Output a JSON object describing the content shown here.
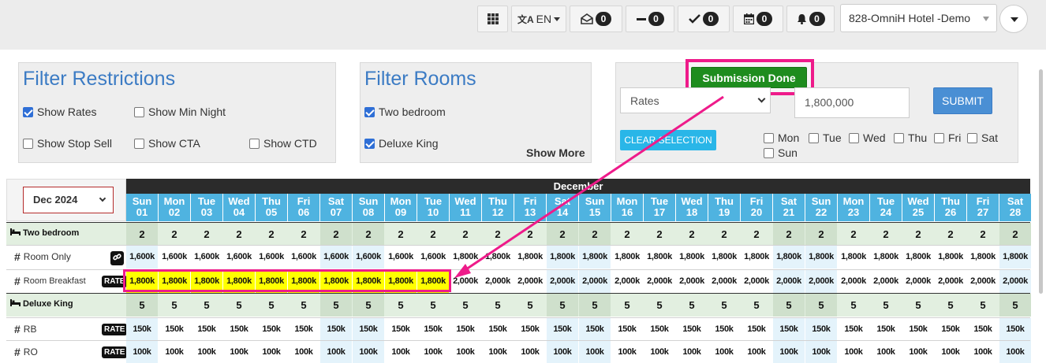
{
  "header": {
    "grid_menu_icon": "grid-icon",
    "language": "EN",
    "counters": [
      {
        "icon": "envelope-open-icon",
        "count": "0"
      },
      {
        "icon": "minus-icon",
        "count": "0"
      },
      {
        "icon": "check-icon",
        "count": "0"
      },
      {
        "icon": "calendar-icon",
        "count": "0"
      },
      {
        "icon": "bell-icon",
        "count": "0"
      }
    ],
    "hotel": "828-OmniH Hotel -Demo"
  },
  "filter_restrictions": {
    "title": "Filter Restrictions",
    "options": [
      {
        "label": "Show Rates",
        "checked": true
      },
      {
        "label": "Show Min Night",
        "checked": false
      },
      {
        "label": "Show Stop Sell",
        "checked": false
      },
      {
        "label": "Show CTA",
        "checked": false
      },
      {
        "label": "Show CTD",
        "checked": false
      }
    ]
  },
  "filter_rooms": {
    "title": "Filter Rooms",
    "options": [
      {
        "label": "Two bedroom",
        "checked": true
      },
      {
        "label": "Deluxe King",
        "checked": true
      }
    ],
    "show_more": "Show More"
  },
  "bulk_update": {
    "status": "Submission Done",
    "type_select": "Rates",
    "value": "1,800,000",
    "submit": "SUBMIT",
    "clear": "CLEAR SELECTION",
    "days": [
      {
        "label": "Mon",
        "checked": false
      },
      {
        "label": "Tue",
        "checked": false
      },
      {
        "label": "Wed",
        "checked": false
      },
      {
        "label": "Thu",
        "checked": false
      },
      {
        "label": "Fri",
        "checked": false
      },
      {
        "label": "Sat",
        "checked": false
      },
      {
        "label": "Sun",
        "checked": false
      }
    ]
  },
  "calendar": {
    "month_select": "Dec 2024",
    "month_label": "December",
    "days": [
      {
        "dow": "Sun",
        "d": "01"
      },
      {
        "dow": "Mon",
        "d": "02"
      },
      {
        "dow": "Tue",
        "d": "03"
      },
      {
        "dow": "Wed",
        "d": "04"
      },
      {
        "dow": "Thu",
        "d": "05"
      },
      {
        "dow": "Fri",
        "d": "06"
      },
      {
        "dow": "Sat",
        "d": "07"
      },
      {
        "dow": "Sun",
        "d": "08"
      },
      {
        "dow": "Mon",
        "d": "09"
      },
      {
        "dow": "Tue",
        "d": "10"
      },
      {
        "dow": "Wed",
        "d": "11"
      },
      {
        "dow": "Thu",
        "d": "12"
      },
      {
        "dow": "Fri",
        "d": "13"
      },
      {
        "dow": "Sat",
        "d": "14"
      },
      {
        "dow": "Sun",
        "d": "15"
      },
      {
        "dow": "Mon",
        "d": "16"
      },
      {
        "dow": "Tue",
        "d": "17"
      },
      {
        "dow": "Wed",
        "d": "18"
      },
      {
        "dow": "Thu",
        "d": "19"
      },
      {
        "dow": "Fri",
        "d": "20"
      },
      {
        "dow": "Sat",
        "d": "21"
      },
      {
        "dow": "Sun",
        "d": "22"
      },
      {
        "dow": "Mon",
        "d": "23"
      },
      {
        "dow": "Tue",
        "d": "24"
      },
      {
        "dow": "Wed",
        "d": "25"
      },
      {
        "dow": "Thu",
        "d": "26"
      },
      {
        "dow": "Fri",
        "d": "27"
      },
      {
        "dow": "Sat",
        "d": "28"
      }
    ],
    "rows": [
      {
        "kind": "room",
        "label": "Two bedroom",
        "icon": "bed-icon",
        "values": [
          "2",
          "2",
          "2",
          "2",
          "2",
          "2",
          "2",
          "2",
          "2",
          "2",
          "2",
          "2",
          "2",
          "2",
          "2",
          "2",
          "2",
          "2",
          "2",
          "2",
          "2",
          "2",
          "2",
          "2",
          "2",
          "2",
          "2",
          "2"
        ]
      },
      {
        "kind": "rate",
        "label": "Room Only",
        "tag_icon": "link-icon",
        "values": [
          "1,600k",
          "1,600k",
          "1,600k",
          "1,600k",
          "1,600k",
          "1,600k",
          "1,600k",
          "1,600k",
          "1,600k",
          "1,600k",
          "1,800k",
          "1,800k",
          "1,800k",
          "1,800k",
          "1,800k",
          "1,800k",
          "1,800k",
          "1,800k",
          "1,800k",
          "1,800k",
          "1,800k",
          "1,800k",
          "1,800k",
          "1,800k",
          "1,800k",
          "1,800k",
          "1,800k",
          "1,800k"
        ]
      },
      {
        "kind": "rate",
        "label": "Room Breakfast",
        "tag": "RATE",
        "highlight_count": 10,
        "values": [
          "1,800k",
          "1,800k",
          "1,800k",
          "1,800k",
          "1,800k",
          "1,800k",
          "1,800k",
          "1,800k",
          "1,800k",
          "1,800k",
          "2,000k",
          "2,000k",
          "2,000k",
          "2,000k",
          "2,000k",
          "2,000k",
          "2,000k",
          "2,000k",
          "2,000k",
          "2,000k",
          "2,000k",
          "2,000k",
          "2,000k",
          "2,000k",
          "2,000k",
          "2,000k",
          "2,000k",
          "2,000k"
        ]
      },
      {
        "kind": "room",
        "label": "Deluxe King",
        "icon": "bed-icon",
        "values": [
          "5",
          "5",
          "5",
          "5",
          "5",
          "5",
          "5",
          "5",
          "5",
          "5",
          "5",
          "5",
          "5",
          "5",
          "5",
          "5",
          "5",
          "5",
          "5",
          "5",
          "5",
          "5",
          "5",
          "5",
          "5",
          "5",
          "5",
          "5"
        ]
      },
      {
        "kind": "rate",
        "label": "RB",
        "tag": "RATE",
        "values": [
          "150k",
          "150k",
          "150k",
          "150k",
          "150k",
          "150k",
          "150k",
          "150k",
          "150k",
          "150k",
          "150k",
          "150k",
          "150k",
          "150k",
          "150k",
          "150k",
          "150k",
          "150k",
          "150k",
          "150k",
          "150k",
          "150k",
          "150k",
          "150k",
          "150k",
          "150k",
          "150k",
          "150k"
        ]
      },
      {
        "kind": "rate",
        "label": "RO",
        "tag": "RATE",
        "values": [
          "100k",
          "100k",
          "100k",
          "100k",
          "100k",
          "100k",
          "100k",
          "100k",
          "100k",
          "100k",
          "100k",
          "100k",
          "100k",
          "100k",
          "100k",
          "100k",
          "100k",
          "100k",
          "100k",
          "100k",
          "100k",
          "100k",
          "100k",
          "100k",
          "100k",
          "100k",
          "100k",
          "100k"
        ]
      }
    ]
  },
  "colors": {
    "header_blue": "#4fb3e0",
    "room_row": "#e2efe0",
    "weekend_room": "#cfe0cc",
    "weekend_rate": "#e4f3fb",
    "highlight": "#ffff00",
    "annotation": "#ee1b8a"
  }
}
